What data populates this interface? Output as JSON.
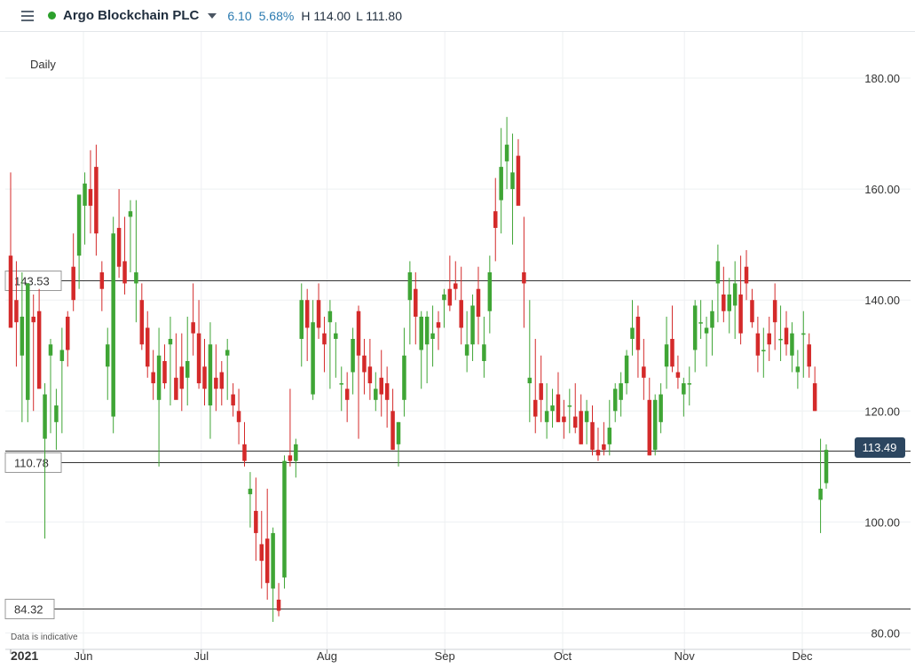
{
  "header": {
    "title": "Argo Blockchain PLC",
    "change": "6.10",
    "change_pct": "5.68%",
    "high": "H 114.00",
    "low": "L 111.80",
    "status_color": "#2ca02c",
    "icons": [
      "menu-icon",
      "caret-down-icon"
    ]
  },
  "chart_data": {
    "type": "candlestick",
    "interval_label": "Daily",
    "disclaimer": "Data is indicative",
    "y_range": [
      78,
      188
    ],
    "y_ticks": [
      80,
      100,
      120,
      140,
      160,
      180
    ],
    "y_tick_labels": [
      "80.00",
      "100.00",
      "120.00",
      "140.00",
      "160.00",
      "180.00"
    ],
    "x_labels": [
      {
        "label": "2021",
        "date": "2021-05-11"
      },
      {
        "label": "Jun",
        "date": "2021-06-01"
      },
      {
        "label": "Jul",
        "date": "2021-07-01"
      },
      {
        "label": "Aug",
        "date": "2021-08-02"
      },
      {
        "label": "Sep",
        "date": "2021-09-01"
      },
      {
        "label": "Oct",
        "date": "2021-10-01"
      },
      {
        "label": "Nov",
        "date": "2021-11-01"
      },
      {
        "label": "Dec",
        "date": "2021-12-01"
      }
    ],
    "horizontal_lines": [
      {
        "value": 143.53,
        "label": "143.53"
      },
      {
        "value": 112.9,
        "label": ""
      },
      {
        "value": 110.78,
        "label": "110.78"
      },
      {
        "value": 84.32,
        "label": "84.32"
      }
    ],
    "last_price": {
      "value": 113.49,
      "label": "113.49",
      "color": "#2c4660"
    },
    "up_color": "#3fa535",
    "down_color": "#d42a2a",
    "candles": [
      {
        "o": 148,
        "h": 163,
        "l": 140,
        "c": 135
      },
      {
        "o": 140,
        "h": 147,
        "l": 128,
        "c": 136
      },
      {
        "o": 130,
        "h": 145,
        "l": 118,
        "c": 137
      },
      {
        "o": 122,
        "h": 140,
        "l": 118,
        "c": 143
      },
      {
        "o": 137,
        "h": 141,
        "l": 120,
        "c": 136
      },
      {
        "o": 138,
        "h": 142,
        "l": 128,
        "c": 124
      },
      {
        "o": 115,
        "h": 125,
        "l": 97,
        "c": 123
      },
      {
        "o": 130,
        "h": 133,
        "l": 116,
        "c": 132
      },
      {
        "o": 118,
        "h": 124,
        "l": 113,
        "c": 121
      },
      {
        "o": 129,
        "h": 135,
        "l": 116,
        "c": 131
      },
      {
        "o": 137,
        "h": 138,
        "l": 128,
        "c": 131
      },
      {
        "o": 146,
        "h": 152,
        "l": 138,
        "c": 140
      },
      {
        "o": 148,
        "h": 155,
        "l": 142,
        "c": 159
      },
      {
        "o": 157,
        "h": 163,
        "l": 150,
        "c": 161
      },
      {
        "o": 160,
        "h": 167,
        "l": 152,
        "c": 157
      },
      {
        "o": 164,
        "h": 168,
        "l": 148,
        "c": 152
      },
      {
        "o": 145,
        "h": 147,
        "l": 138,
        "c": 142
      },
      {
        "o": 128,
        "h": 135,
        "l": 122,
        "c": 132
      },
      {
        "o": 119,
        "h": 155,
        "l": 116,
        "c": 152
      },
      {
        "o": 153,
        "h": 160,
        "l": 144,
        "c": 146
      },
      {
        "o": 147,
        "h": 155,
        "l": 141,
        "c": 143
      },
      {
        "o": 155,
        "h": 158,
        "l": 145,
        "c": 156
      },
      {
        "o": 143,
        "h": 158,
        "l": 136,
        "c": 145
      },
      {
        "o": 140,
        "h": 143,
        "l": 131,
        "c": 132
      },
      {
        "o": 135,
        "h": 138,
        "l": 126,
        "c": 128
      },
      {
        "o": 127,
        "h": 131,
        "l": 122,
        "c": 125
      },
      {
        "o": 122,
        "h": 135,
        "l": 110,
        "c": 130
      },
      {
        "o": 129,
        "h": 132,
        "l": 124,
        "c": 125
      },
      {
        "o": 132,
        "h": 137,
        "l": 121,
        "c": 133
      },
      {
        "o": 126,
        "h": 134,
        "l": 123,
        "c": 122
      },
      {
        "o": 128,
        "h": 134,
        "l": 120,
        "c": 124
      },
      {
        "o": 126,
        "h": 137,
        "l": 121,
        "c": 129
      },
      {
        "o": 136,
        "h": 143,
        "l": 130,
        "c": 134
      },
      {
        "o": 134,
        "h": 140,
        "l": 124,
        "c": 125
      },
      {
        "o": 128,
        "h": 133,
        "l": 121,
        "c": 124
      },
      {
        "o": 121,
        "h": 136,
        "l": 115,
        "c": 132
      },
      {
        "o": 126,
        "h": 132,
        "l": 120,
        "c": 124
      },
      {
        "o": 127,
        "h": 129,
        "l": 121,
        "c": 124
      },
      {
        "o": 130,
        "h": 133,
        "l": 122,
        "c": 131
      },
      {
        "o": 123,
        "h": 125,
        "l": 119,
        "c": 121
      },
      {
        "o": 120,
        "h": 124,
        "l": 114,
        "c": 118
      },
      {
        "o": 114,
        "h": 118,
        "l": 110,
        "c": 111
      },
      {
        "o": 105,
        "h": 109,
        "l": 99,
        "c": 106
      },
      {
        "o": 102,
        "h": 108,
        "l": 93,
        "c": 98
      },
      {
        "o": 96,
        "h": 102,
        "l": 88,
        "c": 93
      },
      {
        "o": 97,
        "h": 106,
        "l": 86,
        "c": 89
      },
      {
        "o": 88,
        "h": 99,
        "l": 82,
        "c": 98
      },
      {
        "o": 86,
        "h": 89,
        "l": 83,
        "c": 84
      },
      {
        "o": 90,
        "h": 112,
        "l": 88,
        "c": 111
      },
      {
        "o": 112,
        "h": 124,
        "l": 110,
        "c": 111
      },
      {
        "o": 111,
        "h": 115,
        "l": 108,
        "c": 114
      },
      {
        "o": 133,
        "h": 143,
        "l": 128,
        "c": 140
      },
      {
        "o": 140,
        "h": 142,
        "l": 129,
        "c": 135
      },
      {
        "o": 123,
        "h": 140,
        "l": 122,
        "c": 136
      },
      {
        "o": 140,
        "h": 143,
        "l": 133,
        "c": 135
      },
      {
        "o": 134,
        "h": 137,
        "l": 127,
        "c": 132
      },
      {
        "o": 136,
        "h": 140,
        "l": 124,
        "c": 138
      },
      {
        "o": 133,
        "h": 136,
        "l": 126,
        "c": 134
      },
      {
        "o": 125,
        "h": 128,
        "l": 120,
        "c": 125
      },
      {
        "o": 124,
        "h": 127,
        "l": 118,
        "c": 122
      },
      {
        "o": 127,
        "h": 135,
        "l": 123,
        "c": 133
      },
      {
        "o": 138,
        "h": 139,
        "l": 115,
        "c": 130
      },
      {
        "o": 130,
        "h": 133,
        "l": 123,
        "c": 127
      },
      {
        "o": 128,
        "h": 133,
        "l": 122,
        "c": 125
      },
      {
        "o": 122,
        "h": 127,
        "l": 120,
        "c": 124
      },
      {
        "o": 126,
        "h": 131,
        "l": 119,
        "c": 123
      },
      {
        "o": 125,
        "h": 128,
        "l": 117,
        "c": 122
      },
      {
        "o": 120,
        "h": 124,
        "l": 113,
        "c": 113
      },
      {
        "o": 114,
        "h": 118,
        "l": 110,
        "c": 118
      },
      {
        "o": 122,
        "h": 135,
        "l": 119,
        "c": 130
      },
      {
        "o": 140,
        "h": 147,
        "l": 132,
        "c": 145
      },
      {
        "o": 142,
        "h": 145,
        "l": 132,
        "c": 137
      },
      {
        "o": 131,
        "h": 138,
        "l": 124,
        "c": 137
      },
      {
        "o": 132,
        "h": 138,
        "l": 125,
        "c": 137
      },
      {
        "o": 133,
        "h": 139,
        "l": 128,
        "c": 134
      },
      {
        "o": 136,
        "h": 138,
        "l": 131,
        "c": 135
      },
      {
        "o": 140,
        "h": 142,
        "l": 135,
        "c": 141
      },
      {
        "o": 142,
        "h": 148,
        "l": 138,
        "c": 139
      },
      {
        "o": 143,
        "h": 147,
        "l": 140,
        "c": 142
      },
      {
        "o": 140,
        "h": 146,
        "l": 132,
        "c": 135
      },
      {
        "o": 130,
        "h": 138,
        "l": 127,
        "c": 132
      },
      {
        "o": 132,
        "h": 141,
        "l": 129,
        "c": 139
      },
      {
        "o": 142,
        "h": 146,
        "l": 132,
        "c": 137
      },
      {
        "o": 129,
        "h": 137,
        "l": 126,
        "c": 132
      },
      {
        "o": 138,
        "h": 148,
        "l": 134,
        "c": 145
      },
      {
        "o": 156,
        "h": 162,
        "l": 147,
        "c": 153
      },
      {
        "o": 158,
        "h": 171,
        "l": 152,
        "c": 164
      },
      {
        "o": 165,
        "h": 173,
        "l": 160,
        "c": 168
      },
      {
        "o": 160,
        "h": 170,
        "l": 150,
        "c": 163
      },
      {
        "o": 166,
        "h": 169,
        "l": 158,
        "c": 157
      },
      {
        "o": 145,
        "h": 155,
        "l": 135,
        "c": 143
      },
      {
        "o": 125,
        "h": 140,
        "l": 118,
        "c": 126
      },
      {
        "o": 122,
        "h": 133,
        "l": 116,
        "c": 119
      },
      {
        "o": 125,
        "h": 130,
        "l": 118,
        "c": 122
      },
      {
        "o": 118,
        "h": 125,
        "l": 115,
        "c": 120
      },
      {
        "o": 120,
        "h": 124,
        "l": 117,
        "c": 121
      },
      {
        "o": 123,
        "h": 127,
        "l": 118,
        "c": 118
      },
      {
        "o": 119,
        "h": 122,
        "l": 115,
        "c": 118
      },
      {
        "o": 121,
        "h": 124,
        "l": 116,
        "c": 121
      },
      {
        "o": 119,
        "h": 125,
        "l": 116,
        "c": 117
      },
      {
        "o": 120,
        "h": 123,
        "l": 114,
        "c": 114
      },
      {
        "o": 118,
        "h": 122,
        "l": 114,
        "c": 120
      },
      {
        "o": 118,
        "h": 121,
        "l": 112,
        "c": 113
      },
      {
        "o": 113,
        "h": 117,
        "l": 111,
        "c": 112
      },
      {
        "o": 114,
        "h": 118,
        "l": 112,
        "c": 113
      },
      {
        "o": 114,
        "h": 122,
        "l": 112,
        "c": 117
      },
      {
        "o": 120,
        "h": 125,
        "l": 118,
        "c": 124
      },
      {
        "o": 122,
        "h": 127,
        "l": 119,
        "c": 125
      },
      {
        "o": 125,
        "h": 131,
        "l": 123,
        "c": 130
      },
      {
        "o": 133,
        "h": 140,
        "l": 130,
        "c": 135
      },
      {
        "o": 137,
        "h": 139,
        "l": 126,
        "c": 131
      },
      {
        "o": 128,
        "h": 133,
        "l": 122,
        "c": 126
      },
      {
        "o": 122,
        "h": 126,
        "l": 112,
        "c": 112
      },
      {
        "o": 113,
        "h": 123,
        "l": 112,
        "c": 122
      },
      {
        "o": 118,
        "h": 125,
        "l": 116,
        "c": 123
      },
      {
        "o": 128,
        "h": 137,
        "l": 124,
        "c": 132
      },
      {
        "o": 133,
        "h": 139,
        "l": 127,
        "c": 128
      },
      {
        "o": 127,
        "h": 130,
        "l": 124,
        "c": 126
      },
      {
        "o": 123,
        "h": 126,
        "l": 119,
        "c": 125
      },
      {
        "o": 125,
        "h": 128,
        "l": 121,
        "c": 125
      },
      {
        "o": 131,
        "h": 140,
        "l": 127,
        "c": 139
      },
      {
        "o": 136,
        "h": 140,
        "l": 133,
        "c": 136
      },
      {
        "o": 134,
        "h": 137,
        "l": 128,
        "c": 135
      },
      {
        "o": 135,
        "h": 140,
        "l": 130,
        "c": 138
      },
      {
        "o": 143,
        "h": 150,
        "l": 136,
        "c": 147
      },
      {
        "o": 141,
        "h": 146,
        "l": 136,
        "c": 138
      },
      {
        "o": 138,
        "h": 144,
        "l": 134,
        "c": 141
      },
      {
        "o": 139,
        "h": 147,
        "l": 133,
        "c": 143
      },
      {
        "o": 141,
        "h": 148,
        "l": 132,
        "c": 134
      },
      {
        "o": 146,
        "h": 149,
        "l": 140,
        "c": 143
      },
      {
        "o": 140,
        "h": 142,
        "l": 135,
        "c": 136
      },
      {
        "o": 134,
        "h": 137,
        "l": 127,
        "c": 130
      },
      {
        "o": 131,
        "h": 135,
        "l": 126,
        "c": 131
      },
      {
        "o": 134,
        "h": 137,
        "l": 129,
        "c": 132
      },
      {
        "o": 140,
        "h": 143,
        "l": 131,
        "c": 136
      },
      {
        "o": 133,
        "h": 139,
        "l": 129,
        "c": 133
      },
      {
        "o": 135,
        "h": 138,
        "l": 130,
        "c": 132
      },
      {
        "o": 130,
        "h": 136,
        "l": 127,
        "c": 134
      },
      {
        "o": 127,
        "h": 131,
        "l": 124,
        "c": 128
      },
      {
        "o": 134,
        "h": 138,
        "l": 126,
        "c": 134
      },
      {
        "o": 132,
        "h": 134,
        "l": 126,
        "c": 128
      },
      {
        "o": 125,
        "h": 128,
        "l": 120,
        "c": 120
      },
      {
        "o": 104,
        "h": 115,
        "l": 98,
        "c": 106
      },
      {
        "o": 107,
        "h": 114,
        "l": 106,
        "c": 113
      }
    ]
  }
}
